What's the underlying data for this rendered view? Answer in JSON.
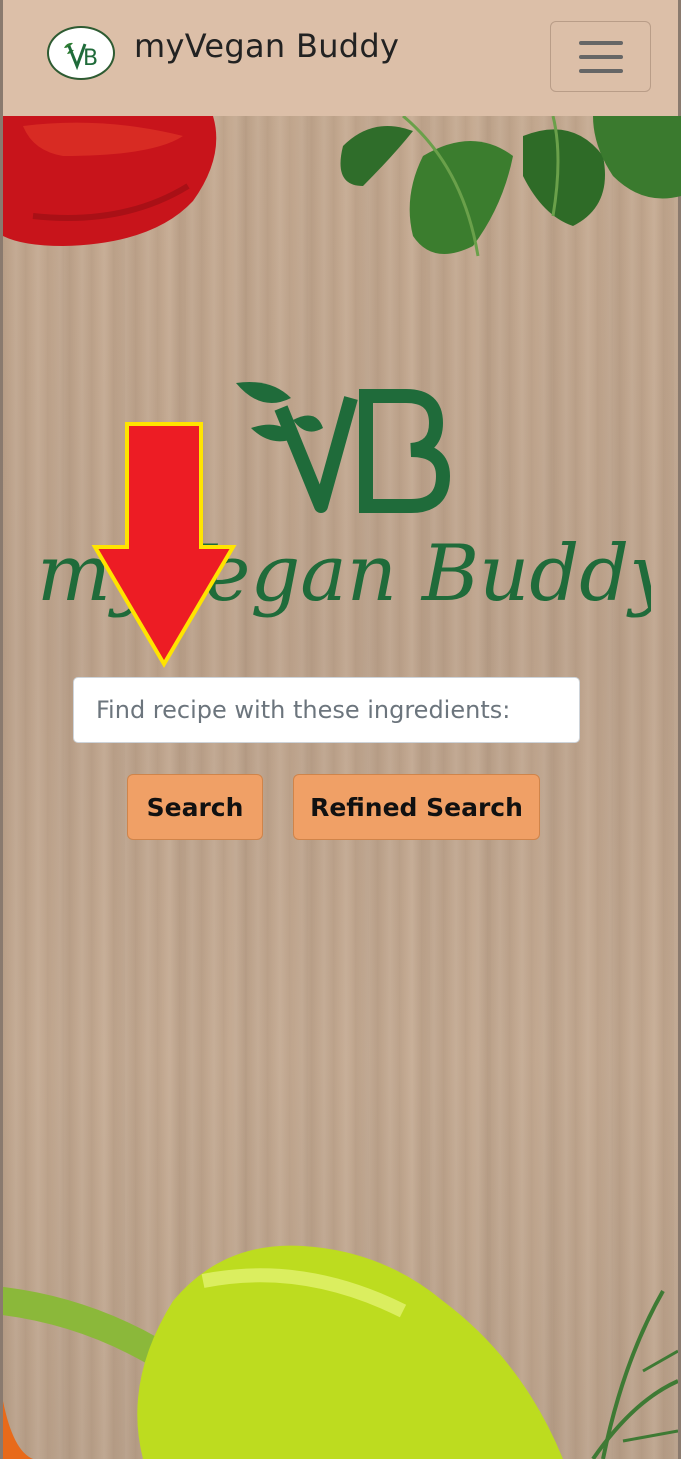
{
  "navbar": {
    "brand": "myVegan Buddy",
    "logo_icon": "vb-leaf-logo-icon",
    "menu_icon": "hamburger-menu-icon"
  },
  "hero": {
    "logo_mark": "VB",
    "logo_wordmark": "myVegan Buddy",
    "annotation_icon": "red-arrow-down-icon"
  },
  "search": {
    "placeholder": "Find recipe with these ingredients:",
    "value": ""
  },
  "buttons": {
    "search_label": "Search",
    "refined_label": "Refined Search"
  },
  "colors": {
    "navbar_bg": "#dcbfa8",
    "brand_green": "#1f6b3a",
    "button_orange": "#f0a066",
    "arrow_red": "#ed1c24",
    "arrow_outline": "#ffe400"
  }
}
